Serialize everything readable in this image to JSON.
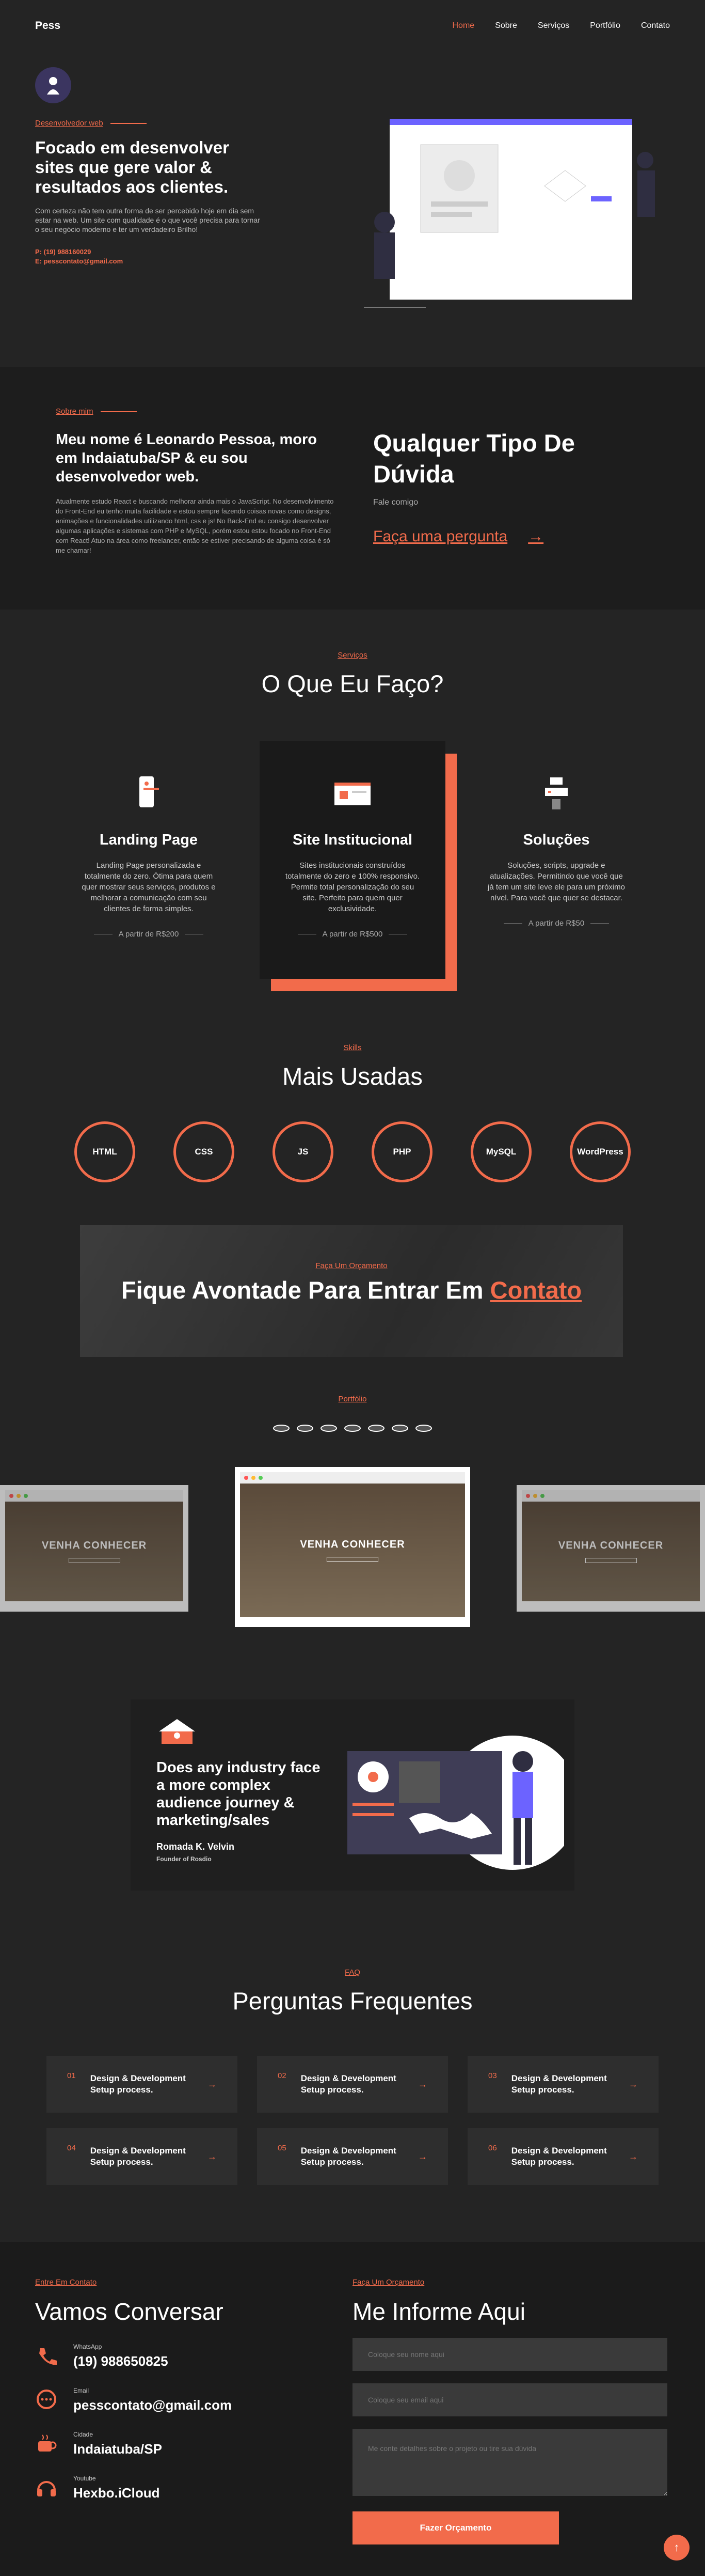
{
  "brand": {
    "logo": "Pess",
    "accent": "#f26b4b",
    "background": "#242424"
  },
  "nav": {
    "items": [
      "Home",
      "Sobre",
      "Serviços",
      "Portfólio",
      "Contato"
    ],
    "active": "Home"
  },
  "hero": {
    "kicker": "Desenvolvedor web",
    "title": "Focado em desenvolver sites que gere valor & resultados aos clientes.",
    "desc": "Com certeza não tem outra forma de ser percebido hoje em dia sem estar na web. Um site com qualidade é o que você precisa para tornar o seu negócio moderno e ter um verdadeiro Brilho!",
    "phone": "P: (19) 988160029",
    "email": "E: pesscontato@gmail.com"
  },
  "about": {
    "kicker": "Sobre mim",
    "title": "Meu nome é Leonardo Pessoa, moro em Indaiatuba/SP & eu sou desenvolvedor web.",
    "desc": "Atualmente estudo React e buscando melhorar ainda mais o JavaScript. No desenvolvimento do Front-End eu tenho muita facilidade e estou sempre fazendo coisas novas como designs, animações e funcionalidades utilizando html, css e js! No Back-End eu consigo desenvolver algumas aplicações e sistemas com PHP e MySQL, porém estou estou focado no Front-End com React! Atuo na área como freelancer, então se estiver precisando de alguma coisa é só me chamar!",
    "side_title": "Qualquer Tipo De Dúvida",
    "side_sub": "Fale comigo",
    "ask": "Faça uma pergunta"
  },
  "services": {
    "kicker": "Serviços",
    "title": "O Que Eu Faço?",
    "cards": [
      {
        "title": "Landing Page",
        "desc": "Landing Page personalizada e totalmente do zero. Ótima para quem quer mostrar seus serviços, produtos e melhorar a comunicação com seu clientes de forma simples.",
        "price": "A partir de R$200"
      },
      {
        "title": "Site Institucional",
        "desc": "Sites institucionais construídos totalmente do zero e 100% responsivo. Permite total personalização do seu site. Perfeito para quem quer exclusividade.",
        "price": "A partir de R$500"
      },
      {
        "title": "Soluções",
        "desc": "Soluções, scripts, upgrade e atualizações. Permitindo que você que já tem um site leve ele para um próximo nível. Para você que quer se destacar.",
        "price": "A partir de R$50"
      }
    ]
  },
  "skills": {
    "kicker": "Skills",
    "title": "Mais Usadas",
    "items": [
      "HTML",
      "CSS",
      "JS",
      "PHP",
      "MySQL",
      "WordPress"
    ]
  },
  "banner": {
    "kicker": "Faça Um Orçamento",
    "title": "Fique Avontade Para Entrar Em",
    "link": "Contato"
  },
  "portfolio": {
    "kicker": "Portfólio",
    "shot_text": "VENHA CONHECER"
  },
  "testimonial": {
    "quote": "Does any industry face a more complex audience journey & marketing/sales",
    "name": "Romada K. Velvin",
    "role": "Founder of Rosdio"
  },
  "faq": {
    "kicker": "FAQ",
    "title": "Perguntas Frequentes",
    "items": [
      {
        "n": "01",
        "q": "Design & Development Setup process."
      },
      {
        "n": "02",
        "q": "Design & Development Setup process."
      },
      {
        "n": "03",
        "q": "Design & Development Setup process."
      },
      {
        "n": "04",
        "q": "Design & Development Setup process."
      },
      {
        "n": "05",
        "q": "Design & Development Setup process."
      },
      {
        "n": "06",
        "q": "Design & Development Setup process."
      }
    ]
  },
  "contact": {
    "kicker": "Entre Em Contato",
    "title": "Vamos Conversar",
    "items": [
      {
        "label": "WhatsApp",
        "value": "(19) 988650825",
        "icon": "phone-icon"
      },
      {
        "label": "Email",
        "value": "pesscontato@gmail.com",
        "icon": "chat-icon"
      },
      {
        "label": "Cidade",
        "value": "Indaiatuba/SP",
        "icon": "coffee-icon"
      },
      {
        "label": "Youtube",
        "value": "Hexbo.iCloud",
        "icon": "headset-icon"
      }
    ]
  },
  "form": {
    "kicker": "Faça Um Orçamento",
    "title": "Me Informe Aqui",
    "name_ph": "Coloque seu nome aqui",
    "email_ph": "Coloque seu email aqui",
    "msg_ph": "Me conte detalhes sobre o projeto ou tire sua dúvida",
    "button": "Fazer Orçamento"
  }
}
